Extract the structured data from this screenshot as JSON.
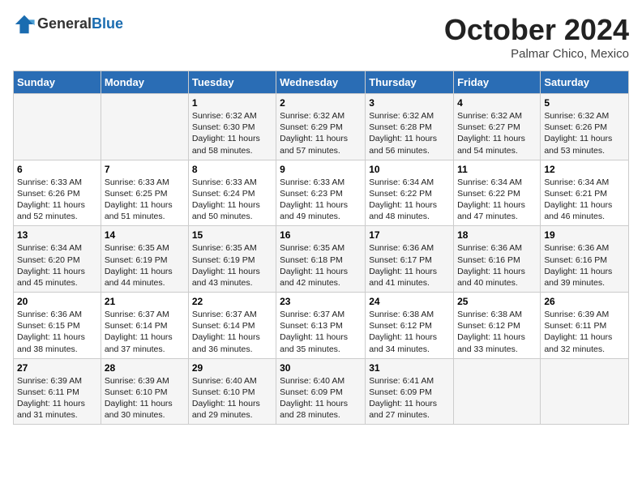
{
  "header": {
    "logo_line1": "General",
    "logo_line2": "Blue",
    "month": "October 2024",
    "location": "Palmar Chico, Mexico"
  },
  "weekdays": [
    "Sunday",
    "Monday",
    "Tuesday",
    "Wednesday",
    "Thursday",
    "Friday",
    "Saturday"
  ],
  "weeks": [
    [
      {
        "day": "",
        "info": ""
      },
      {
        "day": "",
        "info": ""
      },
      {
        "day": "1",
        "info": "Sunrise: 6:32 AM\nSunset: 6:30 PM\nDaylight: 11 hours and 58 minutes."
      },
      {
        "day": "2",
        "info": "Sunrise: 6:32 AM\nSunset: 6:29 PM\nDaylight: 11 hours and 57 minutes."
      },
      {
        "day": "3",
        "info": "Sunrise: 6:32 AM\nSunset: 6:28 PM\nDaylight: 11 hours and 56 minutes."
      },
      {
        "day": "4",
        "info": "Sunrise: 6:32 AM\nSunset: 6:27 PM\nDaylight: 11 hours and 54 minutes."
      },
      {
        "day": "5",
        "info": "Sunrise: 6:32 AM\nSunset: 6:26 PM\nDaylight: 11 hours and 53 minutes."
      }
    ],
    [
      {
        "day": "6",
        "info": "Sunrise: 6:33 AM\nSunset: 6:26 PM\nDaylight: 11 hours and 52 minutes."
      },
      {
        "day": "7",
        "info": "Sunrise: 6:33 AM\nSunset: 6:25 PM\nDaylight: 11 hours and 51 minutes."
      },
      {
        "day": "8",
        "info": "Sunrise: 6:33 AM\nSunset: 6:24 PM\nDaylight: 11 hours and 50 minutes."
      },
      {
        "day": "9",
        "info": "Sunrise: 6:33 AM\nSunset: 6:23 PM\nDaylight: 11 hours and 49 minutes."
      },
      {
        "day": "10",
        "info": "Sunrise: 6:34 AM\nSunset: 6:22 PM\nDaylight: 11 hours and 48 minutes."
      },
      {
        "day": "11",
        "info": "Sunrise: 6:34 AM\nSunset: 6:22 PM\nDaylight: 11 hours and 47 minutes."
      },
      {
        "day": "12",
        "info": "Sunrise: 6:34 AM\nSunset: 6:21 PM\nDaylight: 11 hours and 46 minutes."
      }
    ],
    [
      {
        "day": "13",
        "info": "Sunrise: 6:34 AM\nSunset: 6:20 PM\nDaylight: 11 hours and 45 minutes."
      },
      {
        "day": "14",
        "info": "Sunrise: 6:35 AM\nSunset: 6:19 PM\nDaylight: 11 hours and 44 minutes."
      },
      {
        "day": "15",
        "info": "Sunrise: 6:35 AM\nSunset: 6:19 PM\nDaylight: 11 hours and 43 minutes."
      },
      {
        "day": "16",
        "info": "Sunrise: 6:35 AM\nSunset: 6:18 PM\nDaylight: 11 hours and 42 minutes."
      },
      {
        "day": "17",
        "info": "Sunrise: 6:36 AM\nSunset: 6:17 PM\nDaylight: 11 hours and 41 minutes."
      },
      {
        "day": "18",
        "info": "Sunrise: 6:36 AM\nSunset: 6:16 PM\nDaylight: 11 hours and 40 minutes."
      },
      {
        "day": "19",
        "info": "Sunrise: 6:36 AM\nSunset: 6:16 PM\nDaylight: 11 hours and 39 minutes."
      }
    ],
    [
      {
        "day": "20",
        "info": "Sunrise: 6:36 AM\nSunset: 6:15 PM\nDaylight: 11 hours and 38 minutes."
      },
      {
        "day": "21",
        "info": "Sunrise: 6:37 AM\nSunset: 6:14 PM\nDaylight: 11 hours and 37 minutes."
      },
      {
        "day": "22",
        "info": "Sunrise: 6:37 AM\nSunset: 6:14 PM\nDaylight: 11 hours and 36 minutes."
      },
      {
        "day": "23",
        "info": "Sunrise: 6:37 AM\nSunset: 6:13 PM\nDaylight: 11 hours and 35 minutes."
      },
      {
        "day": "24",
        "info": "Sunrise: 6:38 AM\nSunset: 6:12 PM\nDaylight: 11 hours and 34 minutes."
      },
      {
        "day": "25",
        "info": "Sunrise: 6:38 AM\nSunset: 6:12 PM\nDaylight: 11 hours and 33 minutes."
      },
      {
        "day": "26",
        "info": "Sunrise: 6:39 AM\nSunset: 6:11 PM\nDaylight: 11 hours and 32 minutes."
      }
    ],
    [
      {
        "day": "27",
        "info": "Sunrise: 6:39 AM\nSunset: 6:11 PM\nDaylight: 11 hours and 31 minutes."
      },
      {
        "day": "28",
        "info": "Sunrise: 6:39 AM\nSunset: 6:10 PM\nDaylight: 11 hours and 30 minutes."
      },
      {
        "day": "29",
        "info": "Sunrise: 6:40 AM\nSunset: 6:10 PM\nDaylight: 11 hours and 29 minutes."
      },
      {
        "day": "30",
        "info": "Sunrise: 6:40 AM\nSunset: 6:09 PM\nDaylight: 11 hours and 28 minutes."
      },
      {
        "day": "31",
        "info": "Sunrise: 6:41 AM\nSunset: 6:09 PM\nDaylight: 11 hours and 27 minutes."
      },
      {
        "day": "",
        "info": ""
      },
      {
        "day": "",
        "info": ""
      }
    ]
  ]
}
